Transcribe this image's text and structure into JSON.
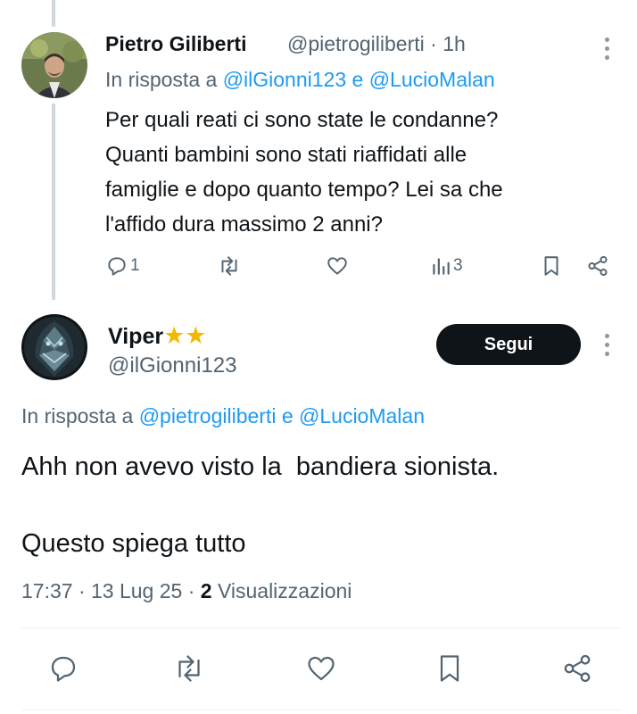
{
  "reply_tweet": {
    "author_name": "Pietro Giliberti",
    "handle": "@pietrogiliberti",
    "time": "· 1h",
    "reply_prefix": "In risposta a",
    "reply_mention_1": "@ilGionni123",
    "reply_conj": "e",
    "reply_mention_2": "@LucioMalan",
    "text_lines": [
      "Per quali reati ci sono state le condanne?",
      "Quanti bambini sono stati riaffidati alle",
      "famiglie e dopo quanto tempo? Lei sa che",
      "l'affido dura massimo 2 anni?"
    ],
    "reply_count": "1",
    "views_count": "3"
  },
  "main_tweet": {
    "author_name": "Viper",
    "stars": "★★",
    "handle": "@ilGionni123",
    "follow_label": "Segui",
    "reply_prefix": "In risposta a",
    "reply_mention_1": "@pietrogiliberti",
    "reply_conj": "e",
    "reply_mention_2": "@LucioMalan",
    "text_line_1": "Ahh non avevo visto la  bandiera sionista.",
    "text_line_2": "Questo spiega tutto",
    "timestamp": "17:37 · 13 Lug 25 ·",
    "views_count": "2",
    "views_label": "Visualizzazioni"
  },
  "colors": {
    "accent": "#1d9bf0",
    "text": "#0f1419",
    "muted": "#536471",
    "star": "#f5b800"
  }
}
